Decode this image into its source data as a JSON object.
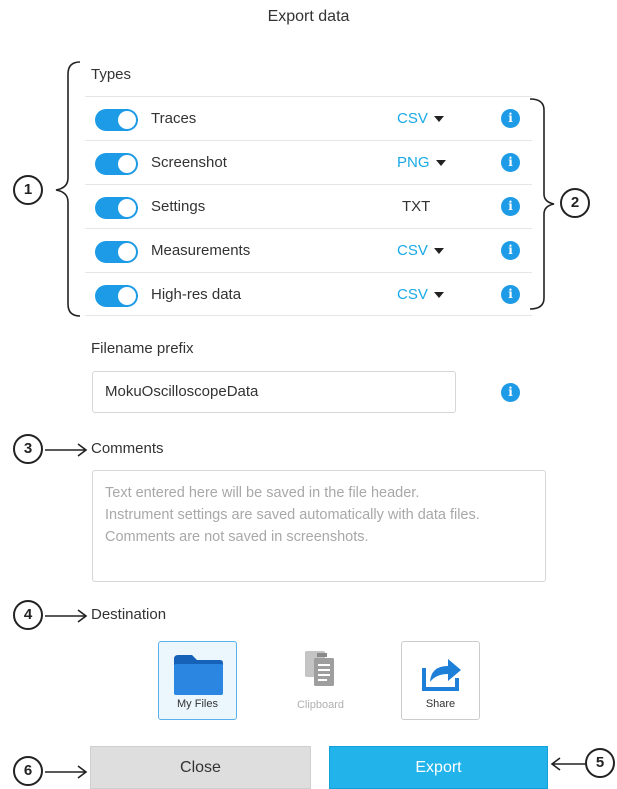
{
  "dialog": {
    "title": "Export data"
  },
  "types": {
    "label": "Types",
    "rows": [
      {
        "name": "Traces",
        "format": "CSV",
        "has_dropdown": true,
        "enabled": true
      },
      {
        "name": "Screenshot",
        "format": "PNG",
        "has_dropdown": true,
        "enabled": true
      },
      {
        "name": "Settings",
        "format": "TXT",
        "has_dropdown": false,
        "enabled": true
      },
      {
        "name": "Measurements",
        "format": "CSV",
        "has_dropdown": true,
        "enabled": true
      },
      {
        "name": "High-res data",
        "format": "CSV",
        "has_dropdown": true,
        "enabled": true
      }
    ]
  },
  "filename": {
    "label": "Filename prefix",
    "value": "MokuOscilloscopeData"
  },
  "comments": {
    "label": "Comments",
    "placeholder": "Text entered here will be saved in the file header.\nInstrument settings are saved automatically with data files.\nComments are not saved in screenshots."
  },
  "destination": {
    "label": "Destination",
    "options": [
      {
        "label": "My Files",
        "icon": "folder-icon",
        "selected": true
      },
      {
        "label": "Clipboard",
        "icon": "clipboard-icon",
        "disabled": true
      },
      {
        "label": "Share",
        "icon": "share-icon"
      }
    ]
  },
  "buttons": {
    "close": "Close",
    "export": "Export"
  },
  "callouts": [
    "1",
    "2",
    "3",
    "4",
    "5",
    "6"
  ],
  "colors": {
    "accent": "#1e9be6",
    "export": "#21b3ea",
    "link_format": "#19a9e6"
  }
}
